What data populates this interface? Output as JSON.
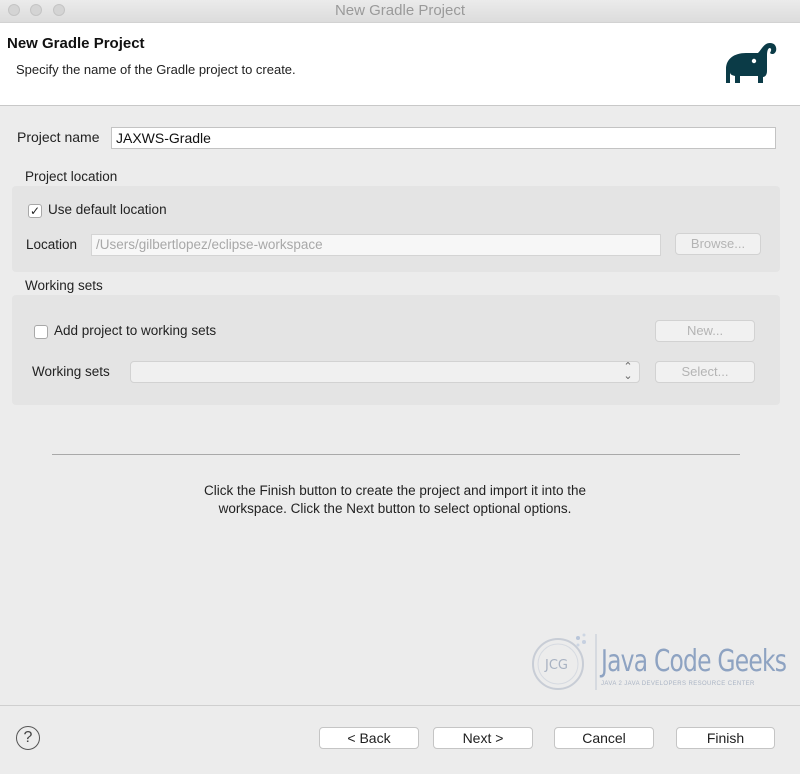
{
  "window": {
    "title": "New Gradle Project"
  },
  "banner": {
    "title": "New Gradle Project",
    "subtitle": "Specify the name of the Gradle project to create.",
    "logo_icon": "gradle-elephant-icon"
  },
  "form": {
    "project_name_label": "Project name",
    "project_name_value": "JAXWS-Gradle",
    "project_location_section": "Project location",
    "use_default_location_label": "Use default location",
    "use_default_location_checked": true,
    "location_label": "Location",
    "location_value": "/Users/gilbertlopez/eclipse-workspace",
    "browse_label": "Browse...",
    "working_sets_section": "Working sets",
    "add_to_working_sets_label": "Add project to working sets",
    "add_to_working_sets_checked": false,
    "new_label": "New...",
    "working_sets_label": "Working sets",
    "working_sets_value": "",
    "select_label": "Select..."
  },
  "hint": {
    "line1": "Click the Finish button to create the project and import it into the",
    "line2": "workspace. Click the Next button to select optional options."
  },
  "watermark": {
    "brand": "Java Code Geeks",
    "tagline": "JAVA 2 JAVA DEVELOPERS RESOURCE CENTER",
    "monogram": "JCG"
  },
  "footer": {
    "help_icon": "help-icon",
    "help_glyph": "?",
    "back_label": "< Back",
    "next_label": "Next >",
    "cancel_label": "Cancel",
    "finish_label": "Finish"
  }
}
